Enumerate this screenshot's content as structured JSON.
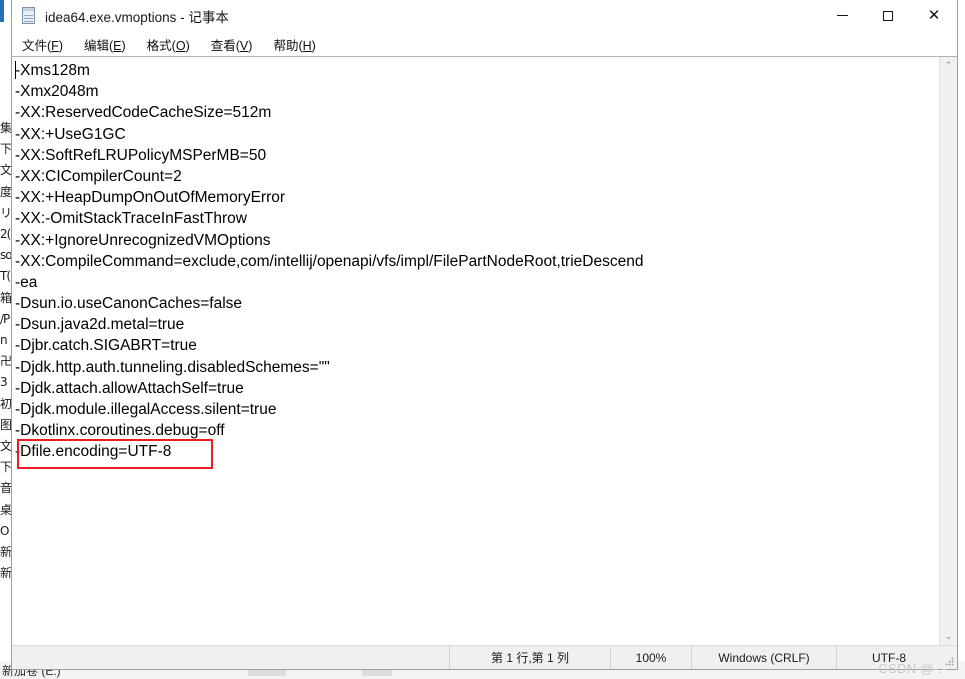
{
  "window": {
    "title": "idea64.exe.vmoptions - 记事本",
    "icon": "notepad-icon",
    "controls": {
      "minimize": "—",
      "maximize": "☐",
      "close": "✕"
    }
  },
  "menubar": {
    "items": [
      {
        "prefix": "文件(",
        "accel": "F",
        "suffix": ")"
      },
      {
        "prefix": "编辑(",
        "accel": "E",
        "suffix": ")"
      },
      {
        "prefix": "格式(",
        "accel": "O",
        "suffix": ")"
      },
      {
        "prefix": "查看(",
        "accel": "V",
        "suffix": ")"
      },
      {
        "prefix": "帮助(",
        "accel": "H",
        "suffix": ")"
      }
    ]
  },
  "editor": {
    "lines": [
      "-Xms128m",
      "-Xmx2048m",
      "-XX:ReservedCodeCacheSize=512m",
      "-XX:+UseG1GC",
      "-XX:SoftRefLRUPolicyMSPerMB=50",
      "-XX:CICompilerCount=2",
      "-XX:+HeapDumpOnOutOfMemoryError",
      "-XX:-OmitStackTraceInFastThrow",
      "-XX:+IgnoreUnrecognizedVMOptions",
      "-XX:CompileCommand=exclude,com/intellij/openapi/vfs/impl/FilePartNodeRoot,trieDescend",
      "-ea",
      "-Dsun.io.useCanonCaches=false",
      "-Dsun.java2d.metal=true",
      "-Djbr.catch.SIGABRT=true",
      "-Djdk.http.auth.tunneling.disabledSchemes=\"\"",
      "-Djdk.attach.allowAttachSelf=true",
      "-Djdk.module.illegalAccess.silent=true",
      "-Dkotlinx.coroutines.debug=off",
      "-Dfile.encoding=UTF-8"
    ],
    "highlight": {
      "line_index": 18,
      "text": "-Dfile.encoding=UTF-8",
      "color": "#ee1c21"
    },
    "caret_line": 1
  },
  "scrollbar": {
    "up_arrow": "⌃",
    "down_arrow": "⌄"
  },
  "statusbar": {
    "position": "第 1 行,第 1 列",
    "zoom": "100%",
    "line_ending": "Windows (CRLF)",
    "encoding": "UTF-8",
    "grip": "resize-grip"
  },
  "watermark": {
    "text": "CSDN @-.-"
  },
  "background": {
    "left_strip_glyphs": "集\n下\n文\n度\nリ)\n2(\nso\nT(\n箱\n/P\nn\n卍\n3\n初\n图\n文\n下\n音\n桌\nO\n新\n新",
    "bottom_text": "新加卷 (E:)"
  }
}
